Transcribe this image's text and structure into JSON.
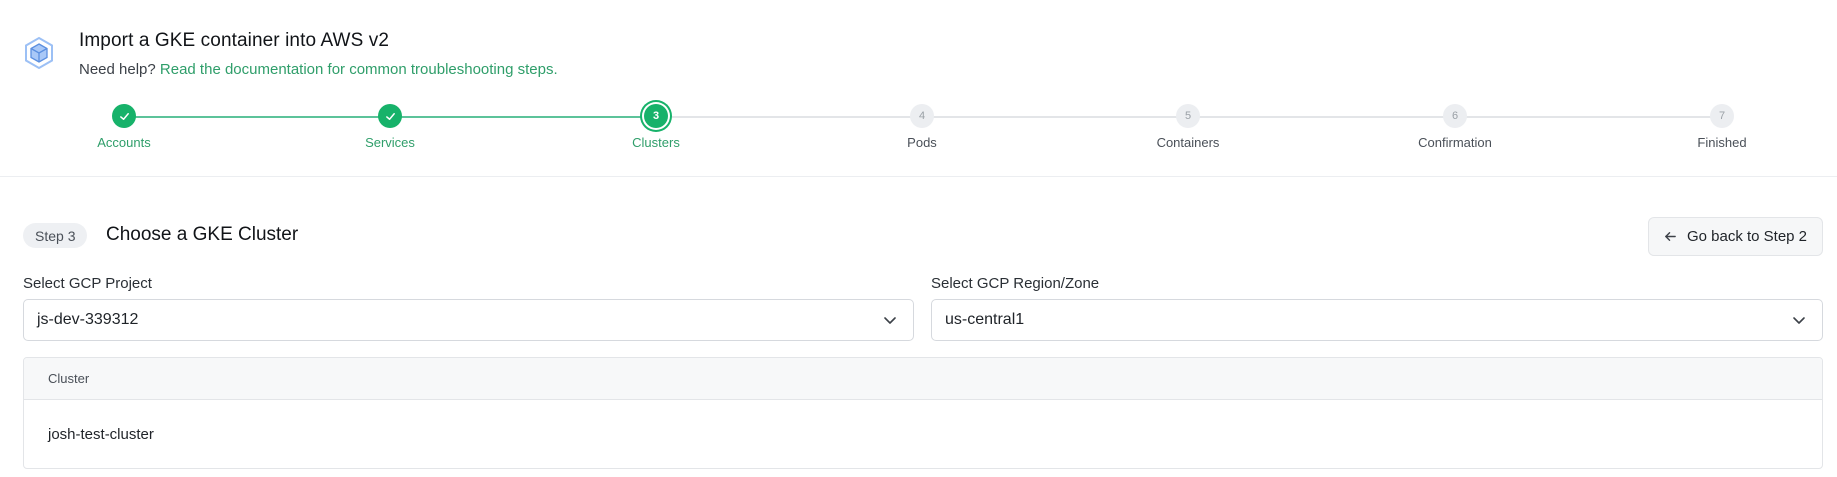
{
  "header": {
    "title": "Import a GKE container into AWS v2",
    "help_prefix": "Need help?",
    "help_link": "Read the documentation for common troubleshooting steps."
  },
  "stepper": {
    "steps": [
      {
        "number": "1",
        "label": "Accounts",
        "state": "complete"
      },
      {
        "number": "2",
        "label": "Services",
        "state": "complete"
      },
      {
        "number": "3",
        "label": "Clusters",
        "state": "current"
      },
      {
        "number": "4",
        "label": "Pods",
        "state": "upcoming"
      },
      {
        "number": "5",
        "label": "Containers",
        "state": "upcoming"
      },
      {
        "number": "6",
        "label": "Confirmation",
        "state": "upcoming"
      },
      {
        "number": "7",
        "label": "Finished",
        "state": "upcoming"
      }
    ]
  },
  "section": {
    "badge": "Step 3",
    "title": "Choose a GKE Cluster",
    "back_button": "Go back to Step 2"
  },
  "project": {
    "label": "Select GCP Project",
    "value": "js-dev-339312"
  },
  "region": {
    "label": "Select GCP Region/Zone",
    "value": "us-central1"
  },
  "table": {
    "columns": [
      "Cluster"
    ],
    "rows": [
      {
        "cluster": "josh-test-cluster"
      }
    ]
  },
  "colors": {
    "accent": "#17b26a",
    "link": "#2f9e6a",
    "logo": "#7aa7f0"
  },
  "icons": {
    "logo": "cube-logo-icon",
    "check": "check-icon",
    "back": "arrow-left-icon",
    "dropdown": "chevron-down-icon"
  }
}
